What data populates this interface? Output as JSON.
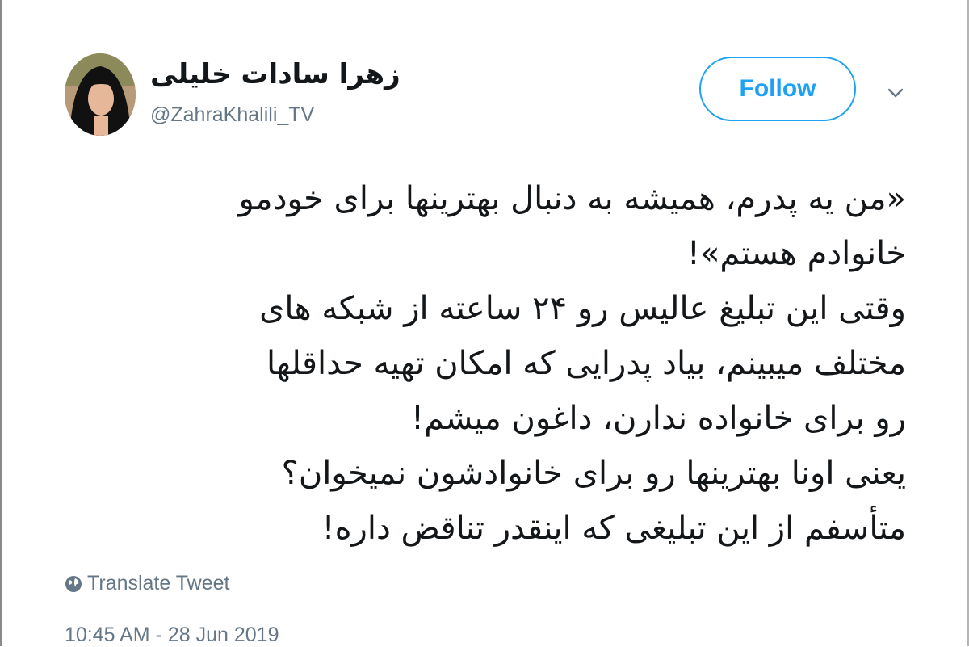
{
  "author": {
    "display_name": "زهرا سادات خلیلی",
    "handle": "@ZahraKhalili_TV",
    "avatar_icon": "profile-photo"
  },
  "actions": {
    "follow_label": "Follow",
    "more_icon": "chevron-down-icon"
  },
  "tweet": {
    "lines": [
      "«من یه پدرم، همیشه به دنبال بهترینها برای خودمو",
      "خانوادم هستم»!",
      "وقتی این تبلیغ عالیس رو ۲۴ ساعته از شبکه های",
      "مختلف میبینم، بیاد پدرایی که امکان تهیه حداقلها",
      "رو برای خانواده ندارن، داغون میشم!",
      "یعنی اونا بهترینها رو برای خانوادشون نمیخوان؟",
      "متأسفم از این تبلیغی که اینقدر تناقض داره!"
    ]
  },
  "footer": {
    "translate_label": "Translate Tweet",
    "translate_icon": "globe-icon",
    "timestamp": "10:45 AM - 28 Jun 2019"
  },
  "colors": {
    "accent": "#1da1f2",
    "text": "#14171a",
    "muted": "#657786"
  }
}
